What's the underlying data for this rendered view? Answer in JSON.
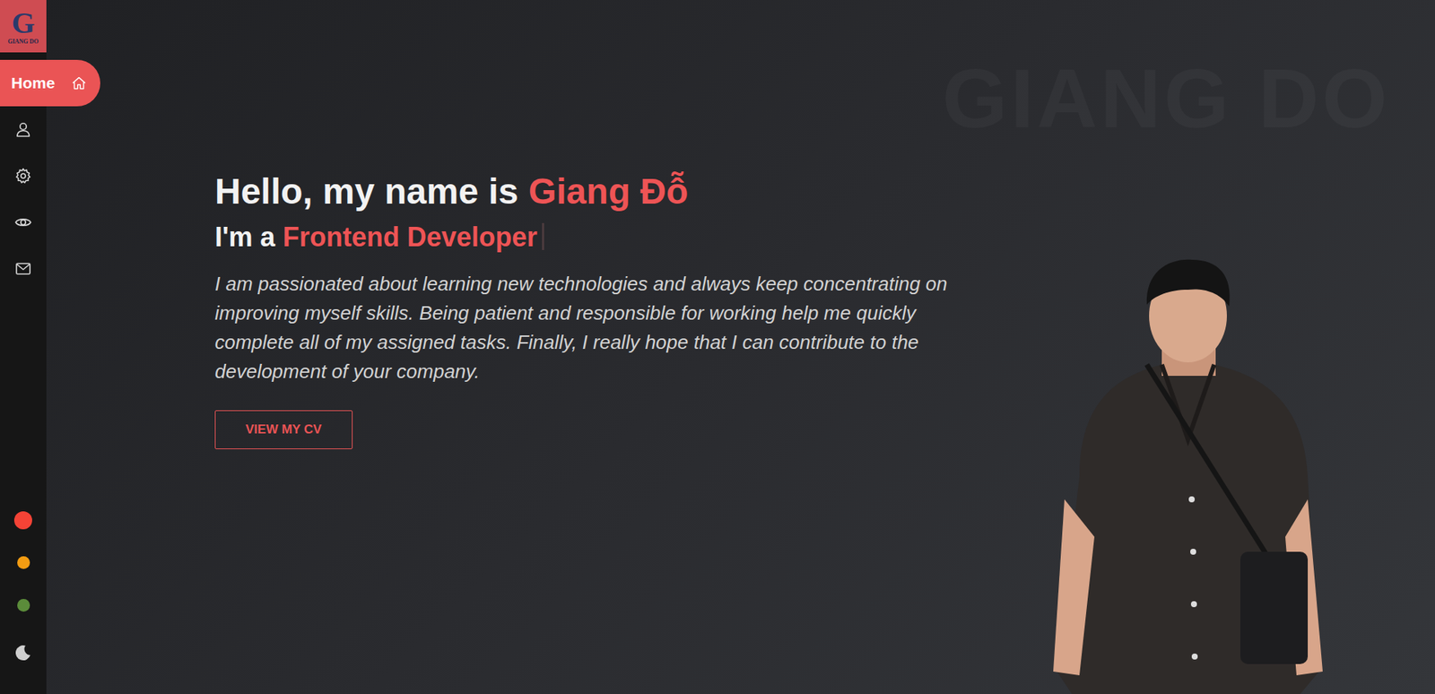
{
  "logo": {
    "letter": "G",
    "text": "GIANG DO"
  },
  "sidebar": {
    "items": [
      {
        "label": "Home",
        "selected": true
      },
      {
        "selected": false
      },
      {
        "selected": false
      },
      {
        "selected": false
      },
      {
        "selected": false
      }
    ]
  },
  "theme_colors": [
    {
      "color": "#f44336",
      "selected": true
    },
    {
      "color": "#f39c12",
      "selected": false
    },
    {
      "color": "#5b8c3a",
      "selected": false
    }
  ],
  "watermark": "GIANG DO",
  "hero": {
    "greeting": "Hello, my name is",
    "name": "Giang Đỗ",
    "role_prefix": "I'm a",
    "role": "Frontend Developer",
    "description": "I am passionated about learning new technologies and always keep concentrating on improving myself skills. Being patient and responsible for working help me quickly complete all of my assigned tasks. Finally, I really hope that I can contribute to the development of your company.",
    "button": "VIEW MY CV"
  }
}
